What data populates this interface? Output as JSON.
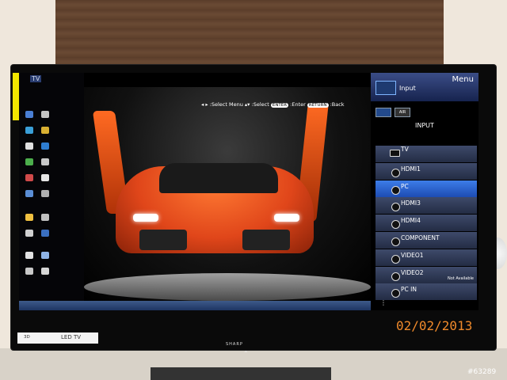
{
  "screen": {
    "source_badge": "TV",
    "help_text": {
      "select_menu": ":Select Menu",
      "select": ":Select",
      "enter_pill": "ENTER",
      "enter": ":Enter",
      "return_pill": "RETURN",
      "back": ":Back"
    },
    "menu": {
      "title": "Menu",
      "header_label": "Input",
      "air_label": "AIR",
      "section_label": "INPUT",
      "items": [
        {
          "label": "TV",
          "selected": false,
          "note": ""
        },
        {
          "label": "HDMI1",
          "selected": false,
          "note": ""
        },
        {
          "label": "PC",
          "selected": true,
          "note": ""
        },
        {
          "label": "HDMI3",
          "selected": false,
          "note": ""
        },
        {
          "label": "HDMI4",
          "selected": false,
          "note": ""
        },
        {
          "label": "COMPONENT",
          "selected": false,
          "note": ""
        },
        {
          "label": "VIDEO1",
          "selected": false,
          "note": ""
        },
        {
          "label": "VIDEO2",
          "selected": false,
          "note": "Not Available"
        },
        {
          "label": "PC IN",
          "selected": false,
          "note": ""
        }
      ],
      "more_indicator": "⋮"
    }
  },
  "tv": {
    "brand": "SHARP",
    "logo_3d": "3D",
    "logo_led": "LED TV"
  },
  "photo": {
    "date_stamp": "02/02/2013",
    "watermark": "#63289"
  }
}
